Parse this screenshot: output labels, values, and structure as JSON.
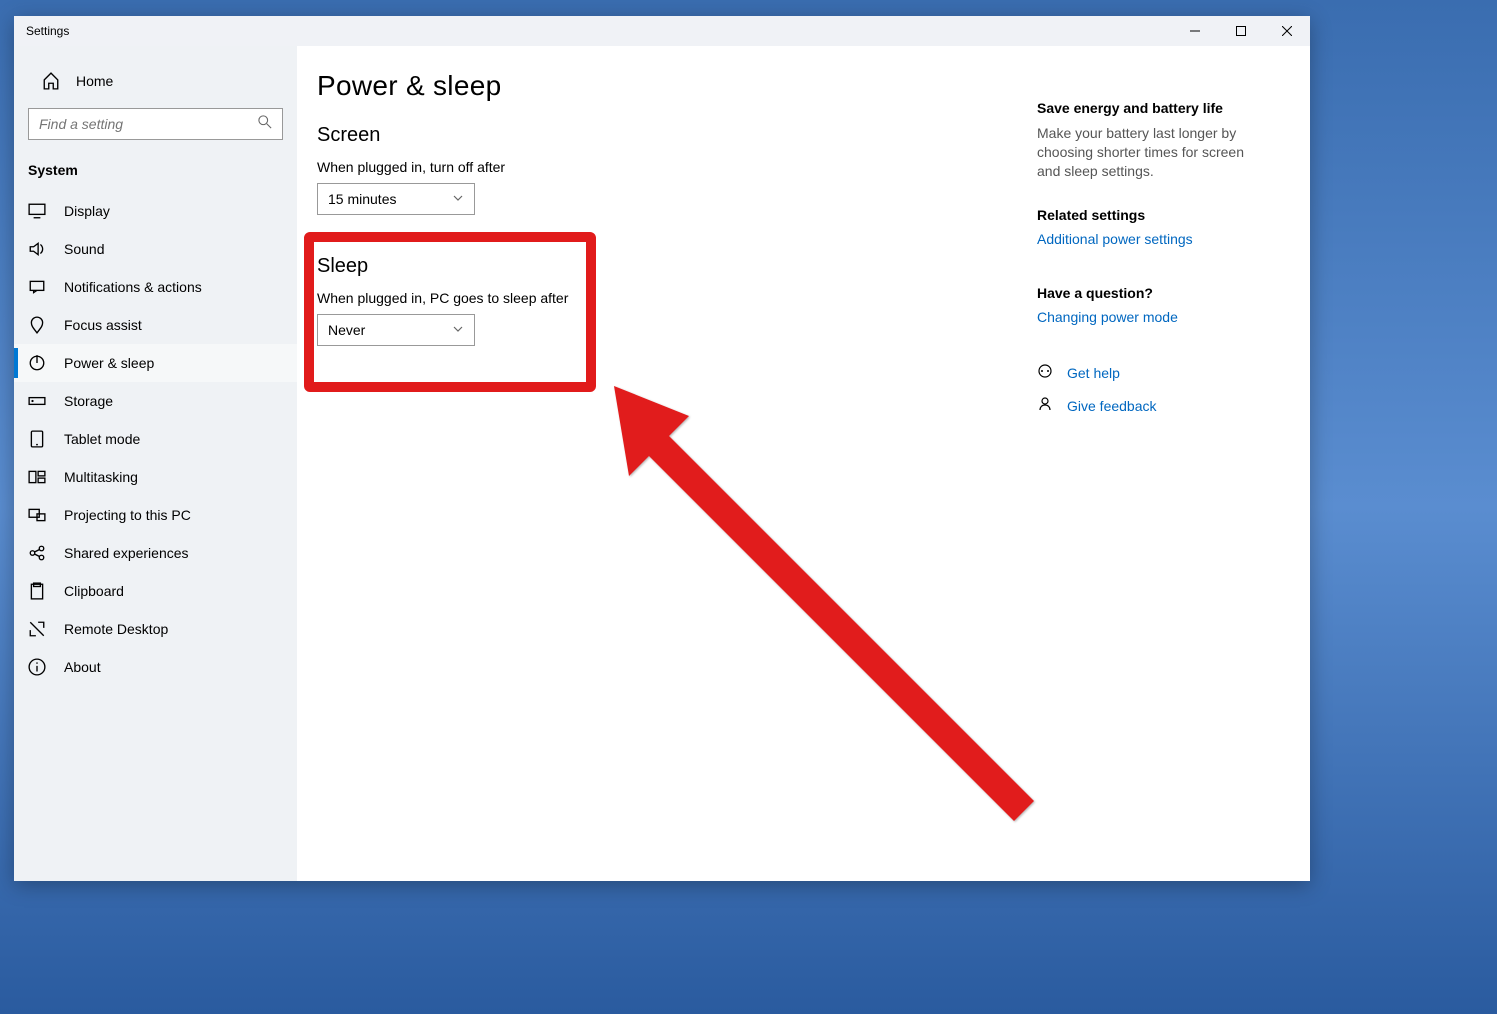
{
  "window": {
    "title": "Settings"
  },
  "sidebar": {
    "home": "Home",
    "search_placeholder": "Find a setting",
    "category": "System",
    "items": [
      {
        "label": "Display"
      },
      {
        "label": "Sound"
      },
      {
        "label": "Notifications & actions"
      },
      {
        "label": "Focus assist"
      },
      {
        "label": "Power & sleep"
      },
      {
        "label": "Storage"
      },
      {
        "label": "Tablet mode"
      },
      {
        "label": "Multitasking"
      },
      {
        "label": "Projecting to this PC"
      },
      {
        "label": "Shared experiences"
      },
      {
        "label": "Clipboard"
      },
      {
        "label": "Remote Desktop"
      },
      {
        "label": "About"
      }
    ]
  },
  "main": {
    "title": "Power & sleep",
    "screen_heading": "Screen",
    "screen_label": "When plugged in, turn off after",
    "screen_value": "15 minutes",
    "sleep_heading": "Sleep",
    "sleep_label": "When plugged in, PC goes to sleep after",
    "sleep_value": "Never"
  },
  "right": {
    "energy_head": "Save energy and battery life",
    "energy_text": "Make your battery last longer by choosing shorter times for screen and sleep settings.",
    "related_head": "Related settings",
    "related_link": "Additional power settings",
    "question_head": "Have a question?",
    "question_link": "Changing power mode",
    "help": "Get help",
    "feedback": "Give feedback"
  },
  "annotation": {
    "highlight_color": "#e11b1b"
  }
}
